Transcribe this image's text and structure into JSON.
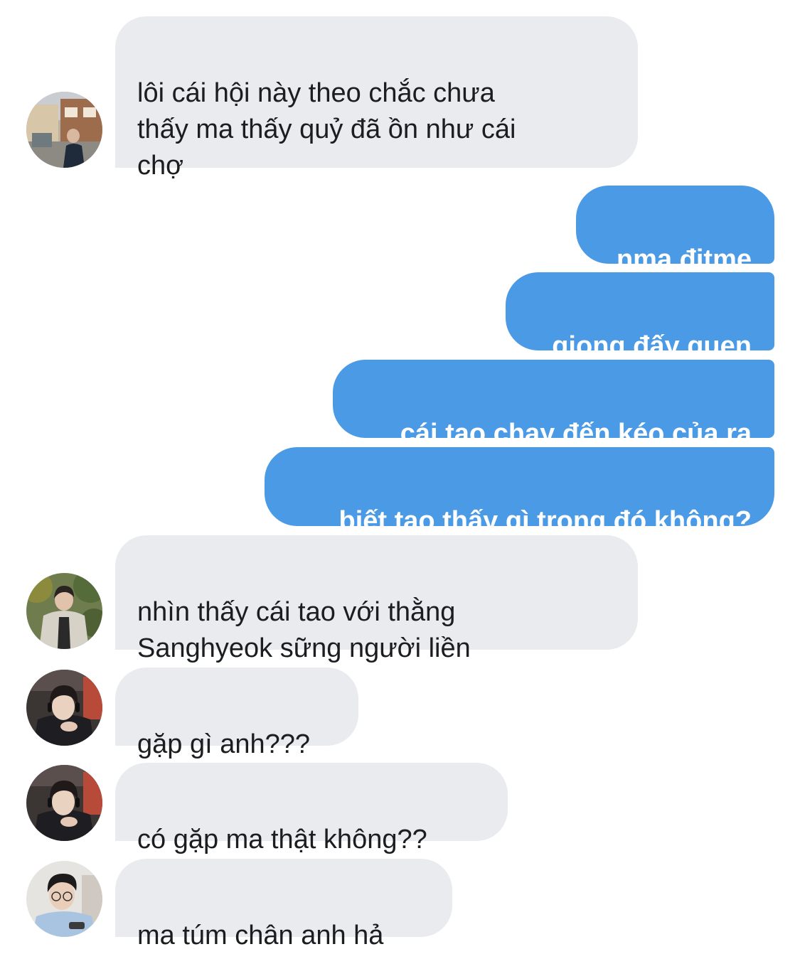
{
  "thread": {
    "messages": [
      {
        "sender": "other",
        "avatar": "avatar-street-photo",
        "text": "lôi cái hội này theo chắc chưa\nthấy ma thấy quỷ đã ồn như cái\nchợ"
      },
      {
        "sender": "me",
        "text": "nma đitme"
      },
      {
        "sender": "me",
        "text": "giọng đấy quen"
      },
      {
        "sender": "me",
        "text": "cái tao chạy đến kéo của ra"
      },
      {
        "sender": "me",
        "text": "biết tao thấy gì trong đó không?"
      },
      {
        "sender": "other",
        "avatar": "avatar-outdoor-photo",
        "text": "nhìn thấy cái tao với thằng\nSanghyeok sững người liền"
      },
      {
        "sender": "other",
        "avatar": "avatar-headset-photo",
        "text": "gặp gì anh???"
      },
      {
        "sender": "other",
        "avatar": "avatar-headset-photo",
        "text": "có gặp ma thật không??"
      },
      {
        "sender": "other",
        "avatar": "avatar-glasses-photo",
        "text": "ma túm chân anh hả"
      }
    ]
  },
  "colors": {
    "incoming_bubble": "#e9ebef",
    "outgoing_bubble": "#4b9ae6",
    "incoming_text": "#1b1d21",
    "outgoing_text": "#ffffff"
  }
}
